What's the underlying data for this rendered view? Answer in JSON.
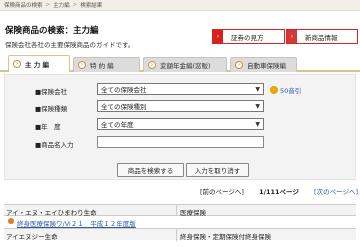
{
  "breadcrumb": [
    "保険商品の検索",
    "主力編",
    "検索結果"
  ],
  "header": {
    "title": "保険商品の検索：主力編",
    "subtitle": "保険会社各社の主要保険商品のガイドです。"
  },
  "header_buttons": {
    "guide": "証券の見方",
    "new_products": "新商品情報"
  },
  "tabs": [
    {
      "label": "主 力 編",
      "active": true
    },
    {
      "label": "特 約 編",
      "active": false
    },
    {
      "label": "変額年金編(窓販)",
      "active": false
    },
    {
      "label": "自動車保険編",
      "active": false
    }
  ],
  "form": {
    "company": {
      "label": "■保険会社",
      "value": "全ての保険会社"
    },
    "type": {
      "label": "■保険種類",
      "value": "全ての保険種別"
    },
    "year": {
      "label": "■年　度",
      "value": "全ての年度"
    },
    "product_name": {
      "label": "■商品名入力",
      "value": ""
    },
    "gojuon": "50音引",
    "search_button": "商品を検索する",
    "clear_button": "入力を取り消す"
  },
  "pager": {
    "prev": "[前のページへ]",
    "current": "1/111ページ",
    "next": "[次のページへ]"
  },
  "results": [
    {
      "company": "アイ・エヌ・エイひまわり生命",
      "category": "医療保険",
      "items": [
        "終身医療保険ワ/Vi２１　平成１２年度版"
      ]
    },
    {
      "company": "アイエヌジー生命",
      "category": "終身保険・定期保険付終身保険",
      "items": []
    }
  ]
}
